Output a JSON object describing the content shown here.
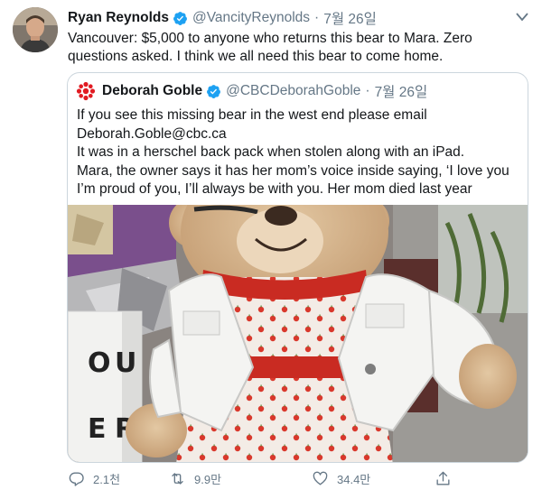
{
  "tweet": {
    "author_name": "Ryan Reynolds",
    "handle": "@VancityReynolds",
    "separator": "·",
    "date": "7월 26일",
    "text": "Vancouver: $5,000 to anyone who returns this bear to Mara. Zero questions asked. I think we all need this bear to come home.",
    "icons": {
      "verified": "verified-badge-icon",
      "more": "chevron-down-icon"
    }
  },
  "quote": {
    "author_name": "Deborah Goble",
    "handle": "@CBCDeborahGoble",
    "separator": "·",
    "date": "7월 26일",
    "lines": [
      "If you see this missing bear in the west end please email",
      "Deborah.Goble@cbc.ca",
      "It was in a herschel back pack when stolen along with an iPad.",
      "Mara, the owner says it has her mom’s voice inside saying, ‘I love you",
      "I’m proud of you, I’ll always be with you. Her mom died last year"
    ],
    "photo": {
      "lightbox_letters": [
        "O",
        "U",
        "E",
        "R"
      ]
    }
  },
  "actions": {
    "reply_count": "2.1천",
    "retweet_count": "9.9만",
    "like_count": "34.4만"
  },
  "colors": {
    "verified": "#1da1f2",
    "muted_text": "#657786",
    "border": "#ccd6dd",
    "cbc_red": "#e11b22"
  }
}
